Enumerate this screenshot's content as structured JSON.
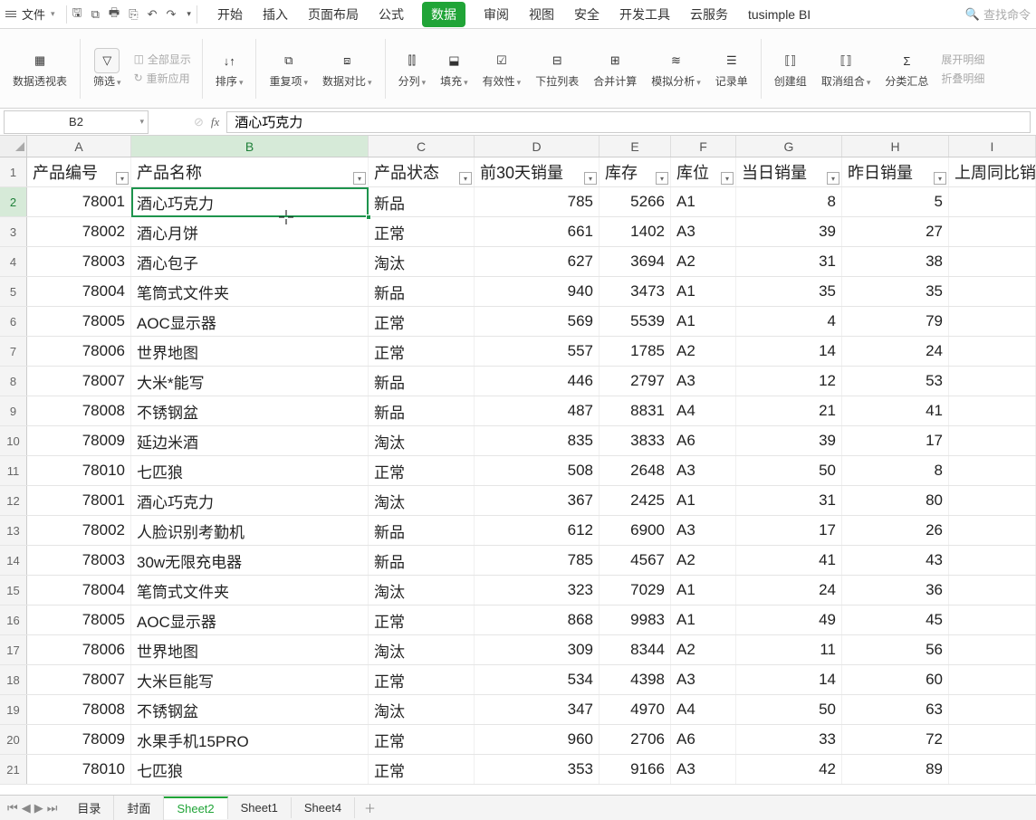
{
  "menu": {
    "file": "文件",
    "tabs": [
      "开始",
      "插入",
      "页面布局",
      "公式",
      "数据",
      "审阅",
      "视图",
      "安全",
      "开发工具",
      "云服务",
      "tusimple BI"
    ],
    "active_tab": "数据",
    "search_placeholder": "查找命令"
  },
  "ribbon": {
    "pivot": "数据透视表",
    "show_all": "全部显示",
    "reapply": "重新应用",
    "filter": "筛选",
    "sort": "排序",
    "dup": "重复项",
    "compare": "数据对比",
    "split": "分列",
    "fill": "填充",
    "valid": "有效性",
    "dropdown": "下拉列表",
    "consolidate": "合并计算",
    "whatif": "模拟分析",
    "record": "记录单",
    "group": "创建组",
    "ungroup": "取消组合",
    "subtotal": "分类汇总",
    "expand": "展开明细",
    "collapse": "折叠明细"
  },
  "namebox": "B2",
  "formula": "酒心巧克力",
  "columns": [
    "A",
    "B",
    "C",
    "D",
    "E",
    "F",
    "G",
    "H",
    "I"
  ],
  "headers": [
    "产品编号",
    "产品名称",
    "产品状态",
    "前30天销量",
    "库存",
    "库位",
    "当日销量",
    "昨日销量",
    "上周同比销"
  ],
  "rows": [
    {
      "n": 2,
      "d": [
        "78001",
        "酒心巧克力",
        "新品",
        "785",
        "5266",
        "A1",
        "8",
        "5",
        ""
      ]
    },
    {
      "n": 3,
      "d": [
        "78002",
        "酒心月饼",
        "正常",
        "661",
        "1402",
        "A3",
        "39",
        "27",
        ""
      ]
    },
    {
      "n": 4,
      "d": [
        "78003",
        "酒心包子",
        "淘汰",
        "627",
        "3694",
        "A2",
        "31",
        "38",
        ""
      ]
    },
    {
      "n": 5,
      "d": [
        "78004",
        "笔筒式文件夹",
        "新品",
        "940",
        "3473",
        "A1",
        "35",
        "35",
        ""
      ]
    },
    {
      "n": 6,
      "d": [
        "78005",
        "AOC显示器",
        "正常",
        "569",
        "5539",
        "A1",
        "4",
        "79",
        ""
      ]
    },
    {
      "n": 7,
      "d": [
        "78006",
        "世界地图",
        "正常",
        "557",
        "1785",
        "A2",
        "14",
        "24",
        ""
      ]
    },
    {
      "n": 8,
      "d": [
        "78007",
        "大米*能写",
        "新品",
        "446",
        "2797",
        "A3",
        "12",
        "53",
        ""
      ]
    },
    {
      "n": 9,
      "d": [
        "78008",
        "不锈钢盆",
        "新品",
        "487",
        "8831",
        "A4",
        "21",
        "41",
        ""
      ]
    },
    {
      "n": 10,
      "d": [
        "78009",
        "延边米酒",
        "淘汰",
        "835",
        "3833",
        "A6",
        "39",
        "17",
        ""
      ]
    },
    {
      "n": 11,
      "d": [
        "78010",
        "七匹狼",
        "正常",
        "508",
        "2648",
        "A3",
        "50",
        "8",
        ""
      ]
    },
    {
      "n": 12,
      "d": [
        "78001",
        "酒心巧克力",
        "淘汰",
        "367",
        "2425",
        "A1",
        "31",
        "80",
        ""
      ]
    },
    {
      "n": 13,
      "d": [
        "78002",
        "人脸识别考勤机",
        "新品",
        "612",
        "6900",
        "A3",
        "17",
        "26",
        ""
      ]
    },
    {
      "n": 14,
      "d": [
        "78003",
        "30w无限充电器",
        "新品",
        "785",
        "4567",
        "A2",
        "41",
        "43",
        ""
      ]
    },
    {
      "n": 15,
      "d": [
        "78004",
        "笔筒式文件夹",
        "淘汰",
        "323",
        "7029",
        "A1",
        "24",
        "36",
        ""
      ]
    },
    {
      "n": 16,
      "d": [
        "78005",
        "AOC显示器",
        "正常",
        "868",
        "9983",
        "A1",
        "49",
        "45",
        ""
      ]
    },
    {
      "n": 17,
      "d": [
        "78006",
        "世界地图",
        "淘汰",
        "309",
        "8344",
        "A2",
        "11",
        "56",
        ""
      ]
    },
    {
      "n": 18,
      "d": [
        "78007",
        "大米巨能写",
        "正常",
        "534",
        "4398",
        "A3",
        "14",
        "60",
        ""
      ]
    },
    {
      "n": 19,
      "d": [
        "78008",
        "不锈钢盆",
        "淘汰",
        "347",
        "4970",
        "A4",
        "50",
        "63",
        ""
      ]
    },
    {
      "n": 20,
      "d": [
        "78009",
        "水果手机15PRO",
        "正常",
        "960",
        "2706",
        "A6",
        "33",
        "72",
        ""
      ]
    },
    {
      "n": 21,
      "d": [
        "78010",
        "七匹狼",
        "正常",
        "353",
        "9166",
        "A3",
        "42",
        "89",
        ""
      ]
    }
  ],
  "sheets": [
    "目录",
    "封面",
    "Sheet2",
    "Sheet1",
    "Sheet4"
  ],
  "active_sheet": "Sheet2",
  "colors": {
    "accent": "#20a437"
  }
}
